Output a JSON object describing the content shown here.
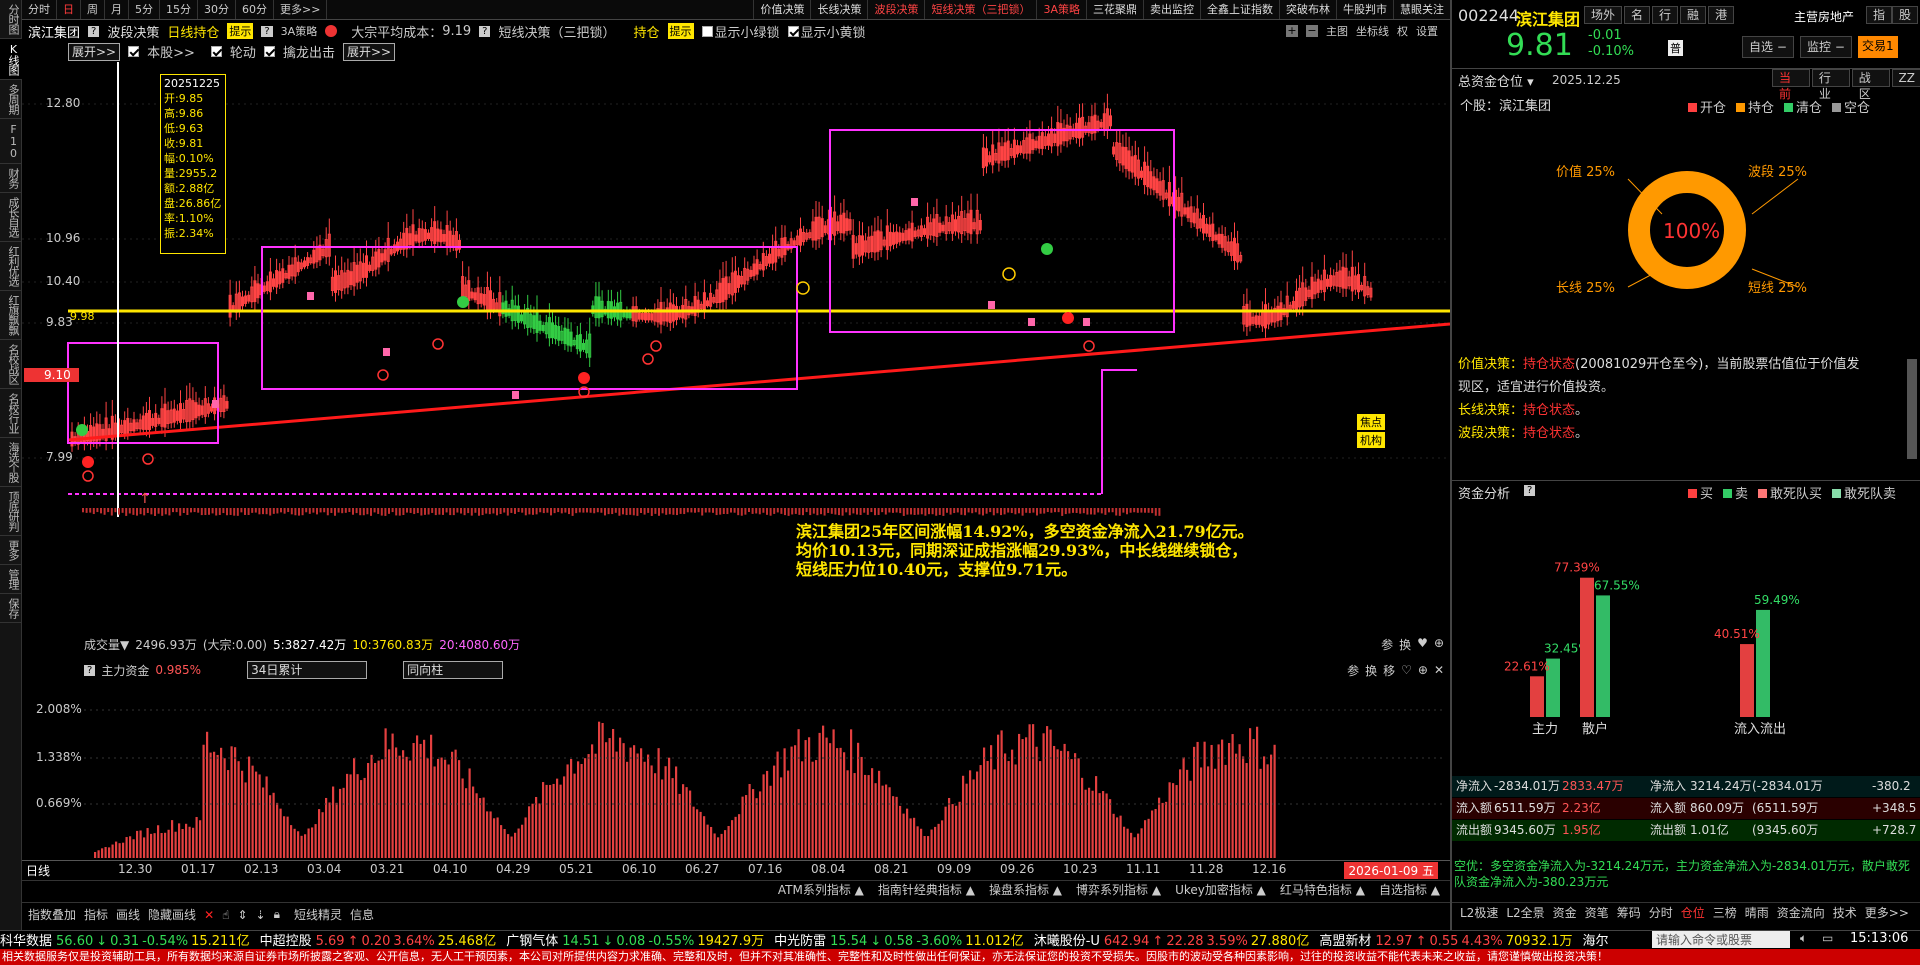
{
  "left_nav": [
    "分时图",
    "K线图",
    "多周期",
    "F10",
    "财务",
    "成长自选",
    "红利优选",
    "红旗飘飘",
    "名校战区",
    "名校行业",
    "海选个股",
    "顶底研判",
    "更多",
    "管理",
    "保存"
  ],
  "period_bar": {
    "items": [
      "分时",
      "日",
      "周",
      "月",
      "5分",
      "15分",
      "30分",
      "60分",
      "更多>>"
    ],
    "active": "日"
  },
  "tool_tabs": [
    {
      "label": "价值决策",
      "red": false
    },
    {
      "label": "长线决策",
      "red": false
    },
    {
      "label": "波段决策",
      "red": true
    },
    {
      "label": "短线决策（三把锁）",
      "red": true
    },
    {
      "label": "3A策略",
      "red": true
    },
    {
      "label": "三花聚鼎",
      "red": false
    },
    {
      "label": "卖出监控",
      "red": false
    },
    {
      "label": "全鑫上证指数",
      "red": false
    },
    {
      "label": "突破布林",
      "red": false
    },
    {
      "label": "牛股判市",
      "red": false
    },
    {
      "label": "慧眼关注",
      "red": false
    }
  ],
  "info_bar": {
    "stock_name": "滨江集团",
    "wave": "波段决策",
    "daily": "日线持仓",
    "hint": "提示",
    "strategy": "3A策略",
    "avg_cost_label": "大宗平均成本：",
    "avg_cost": "9.19",
    "short": "短线决策（三把锁）",
    "hold": "持仓",
    "hint2": "提示",
    "show_green": "显示小绿锁",
    "show_yellow": "显示小黄锁",
    "right_items": [
      "主图",
      "坐标线",
      "权",
      "设置"
    ]
  },
  "chart_options": {
    "expand": "展开>>",
    "this_stock": "本股>>",
    "rotate": "轮动",
    "dragon": "擒龙出击",
    "expand2": "展开>>"
  },
  "tooltip": {
    "date": "20251225",
    "open": "开:9.85",
    "high": "高:9.86",
    "low": "低:9.63",
    "close": "收:9.81",
    "amp": "幅:0.10%",
    "vol": "量:2955.2",
    "amt": "额:2.88亿",
    "pan": "盘:26.86亿",
    "rate": "率:1.10%",
    "zhen": "振:2.34%"
  },
  "price_axis": [
    "12.80",
    "10.96",
    "10.40",
    "9.83",
    "9.10",
    "7.99"
  ],
  "yellow_line_label": "9.98",
  "annotation": {
    "line1": "滨江集团25年区间涨幅14.92%，多空资金净流入21.79亿元。",
    "line2": "均价10.13元，同期深证成指涨幅29.93%，中长线继续锁仓，",
    "line3": "短线压力位10.40元，支撑位9.71元。"
  },
  "side_tags": [
    "焦点",
    "机构"
  ],
  "volume_bar": {
    "label": "成交量▼",
    "v1": "2496.93万",
    "v2": "(大宗:0.00)",
    "ma5": "5:3827.42万",
    "ma10": "10:3760.83万",
    "ma20": "20:4080.60万",
    "icons": [
      "参",
      "换"
    ]
  },
  "fund_panel": {
    "title": "主力资金",
    "value": "0.985%",
    "select1": "34日累计",
    "select2": "同向柱",
    "y_ticks": [
      "2.008%",
      "1.338%",
      "0.669%"
    ],
    "icons": [
      "参",
      "换",
      "移"
    ]
  },
  "date_axis": [
    "12.30",
    "01.17",
    "02.13",
    "03.04",
    "03.21",
    "04.10",
    "04.29",
    "05.21",
    "06.10",
    "06.27",
    "07.16",
    "08.04",
    "08.21",
    "09.09",
    "09.26",
    "10.23",
    "11.11",
    "11.28",
    "12.16"
  ],
  "date_axis_current": "2026-01-09 五",
  "date_axis_left": "日线",
  "indicator_tabs": [
    "ATM系列指标 ▲",
    "指南针经典指标 ▲",
    "操盘系指标 ▲",
    "博弈系列指标 ▲",
    "Ukey加密指标 ▲",
    "红马特色指标 ▲",
    "自选指标 ▲"
  ],
  "toolbar_bottom": [
    "指数叠加",
    "指标",
    "画线",
    "隐藏画线",
    "短线精灵",
    "信息"
  ],
  "right_header": {
    "code": "002244",
    "name": "滨江集团",
    "tabs": [
      "场外",
      "名",
      "行",
      "融",
      "港"
    ],
    "sector": "主营房地产",
    "btn1": "指",
    "btn2": "股",
    "price": "9.81",
    "chg": "-0.01",
    "pct": "-0.10%",
    "badge": "普",
    "self": "自选",
    "monitor": "监控",
    "trade": "交易1"
  },
  "position": {
    "title": "总资金仓位 ▾",
    "date": "2025.12.25",
    "tabs": [
      "当前",
      "行业",
      "战区",
      "ZZ"
    ],
    "stock_label": "个股：滨江集团",
    "legend": [
      "开仓",
      "持仓",
      "清仓",
      "空仓"
    ],
    "legend_colors": [
      "#ff4040",
      "#ff9900",
      "#33cc66",
      "#999999"
    ],
    "center": "100%",
    "labels": [
      "价值 25%",
      "波段 25%",
      "长线 25%",
      "短线 25%"
    ]
  },
  "decisions": [
    {
      "k": "价值决策：",
      "v": "持仓状态",
      "rest": "(20081029开仓至今)，当前股票估值位于价值发现区，适宜进行价值投资。"
    },
    {
      "k": "长线决策：",
      "v": "持仓状态",
      "rest": "。"
    },
    {
      "k": "波段决策：",
      "v": "持仓状态",
      "rest": "。"
    }
  ],
  "fund_analysis": {
    "title": "资金分析",
    "legend": [
      "买",
      "卖",
      "敢死队买",
      "敢死队卖"
    ],
    "legend_colors": [
      "#ff4040",
      "#33cc66",
      "#ff7777",
      "#88ddaa"
    ],
    "groups": [
      {
        "label": "主力",
        "buy": 22.61,
        "sell": 32.45,
        "buy_label": "22.61%",
        "sell_label": "32.45%"
      },
      {
        "label": "散户",
        "buy": 77.39,
        "sell": 67.55,
        "buy_label": "77.39%",
        "sell_label": "67.55%"
      },
      {
        "label": "流入流出",
        "buy": 40.51,
        "sell": 59.49,
        "buy_label": "40.51%",
        "sell_label": "59.49%"
      }
    ]
  },
  "flow_table": [
    {
      "k": "净流入",
      "a": "-2834.01万",
      "b": "2833.47万",
      "k2": "净流入",
      "c": "3214.24万",
      "d": "(-2834.01万",
      "e": "-380.2"
    },
    {
      "k": "流入额",
      "a": "6511.59万",
      "b": "2.23亿",
      "k2": "流入额",
      "c": "860.09万",
      "d": "(6511.59万",
      "e": "+348.5"
    },
    {
      "k": "流出额",
      "a": "9345.60万",
      "b": "1.95亿",
      "k2": "流出额",
      "c": "1.01亿",
      "d": "(9345.60万",
      "e": "+728.7"
    }
  ],
  "flow_note": "空优：多空资金净流入为-3214.24万元，主力资金净流入为-2834.01万元，散户敢死队资金净流入为-380.23万元",
  "right_bottom_tabs": [
    "L2极速",
    "L2全景",
    "资金",
    "资笔",
    "筹码",
    "分时",
    "仓位",
    "三榜",
    "晴雨",
    "资金流向",
    "技术",
    "更多>>"
  ],
  "right_bottom_active": "仓位",
  "ticker": [
    {
      "name": "科华数据",
      "price": "56.60",
      "arrow": "↓",
      "chg": "0.31",
      "pct": "-0.54%",
      "vol": "15.211亿"
    },
    {
      "name": "中超控股",
      "price": "5.69",
      "arrow": "↑",
      "chg": "0.20",
      "pct": "3.64%",
      "vol": "25.468亿"
    },
    {
      "name": "广钢气体",
      "price": "14.51",
      "arrow": "↓",
      "chg": "0.08",
      "pct": "-0.55%",
      "vol": "19427.9万"
    },
    {
      "name": "中光防雷",
      "price": "15.54",
      "arrow": "↓",
      "chg": "0.58",
      "pct": "-3.60%",
      "vol": "11.012亿"
    },
    {
      "name": "沐曦股份-U",
      "price": "642.94",
      "arrow": "↑",
      "chg": "22.28",
      "pct": "3.59%",
      "vol": "27.880亿"
    },
    {
      "name": "高盟新材",
      "price": "12.97",
      "arrow": "↑",
      "chg": "0.55",
      "pct": "4.43%",
      "vol": "70932.1万"
    },
    {
      "name": "海尔",
      "price": "",
      "arrow": "",
      "chg": "",
      "pct": "",
      "vol": ""
    }
  ],
  "command_placeholder": "请输入命令或股票",
  "clock": "15:13:06",
  "disclaimer": "相关数据服务仅是投资辅助工具，所有数据均来源自证券市场所披露之客观、公开信息，无人工干预因素，本公司对所提供内容力求准确、完整和及时，但并不对其准确性、完整性和及时性做出任何保证，亦无法保证您的投资不受损失。因股市的波动受各种因素影响，过往的投资收益不能代表未来之收益，请您谨慎做出投资决策！"
}
